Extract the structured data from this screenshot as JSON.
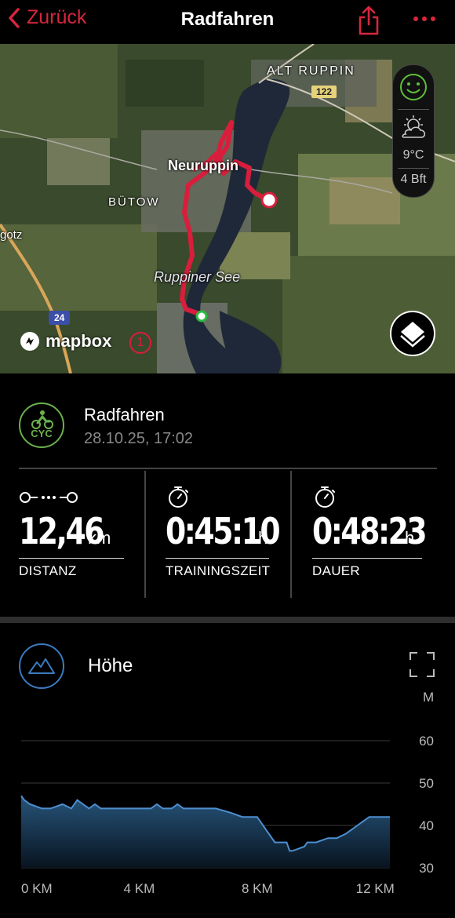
{
  "nav": {
    "back_label": "Zurück",
    "title": "Radfahren"
  },
  "map": {
    "places": {
      "alt_ruppin": "ALT RUPPIN",
      "neuruppin": "Neuruppin",
      "buetow": "BÜTOW",
      "ruppiner_see": "Ruppiner See",
      "gotz": "gotz"
    },
    "road_122": "122",
    "road_24": "24",
    "attribution": "mapbox",
    "info_badge": "1",
    "weather": {
      "temperature": "9°C",
      "wind": "4 Bft"
    }
  },
  "activity": {
    "icon_text": "CYC",
    "name": "Radfahren",
    "datetime": "28.10.25, 17:02"
  },
  "stats": [
    {
      "value": "12,46",
      "unit": "km",
      "label": "DISTANZ"
    },
    {
      "value": "0:45:10",
      "unit": "h",
      "label": "TRAININGSZEIT"
    },
    {
      "value": "0:48:23",
      "unit": "h",
      "label": "DAUER"
    }
  ],
  "altitude": {
    "title": "Höhe",
    "unit": "M"
  },
  "chart_data": {
    "type": "area",
    "title": "Höhe",
    "ylabel": "M",
    "xlabel": "",
    "x_ticks": [
      "0 KM",
      "4 KM",
      "8 KM",
      "12 KM"
    ],
    "y_ticks": [
      60,
      50,
      40,
      30
    ],
    "ylim": [
      30,
      60
    ],
    "xlim": [
      0,
      12.5
    ],
    "grid": true,
    "x": [
      0,
      0.1,
      0.3,
      0.7,
      1.0,
      1.4,
      1.7,
      1.9,
      2.3,
      2.5,
      2.7,
      3.0,
      3.3,
      3.6,
      4.0,
      4.4,
      4.6,
      4.8,
      5.1,
      5.3,
      5.5,
      5.9,
      6.3,
      6.6,
      7.1,
      7.5,
      7.8,
      8.0,
      8.3,
      8.6,
      9.0,
      9.1,
      9.2,
      9.6,
      9.7,
      10.0,
      10.4,
      10.7,
      11.0,
      11.2,
      11.4,
      11.6,
      11.8,
      12.0,
      12.5
    ],
    "y": [
      47,
      46,
      45,
      44,
      44,
      45,
      44,
      46,
      44,
      45,
      44,
      44,
      44,
      44,
      44,
      44,
      45,
      44,
      44,
      45,
      44,
      44,
      44,
      44,
      43,
      42,
      42,
      42,
      39,
      36,
      36,
      34,
      34,
      35,
      36,
      36,
      37,
      37,
      38,
      39,
      40,
      41,
      42,
      42,
      42
    ]
  }
}
